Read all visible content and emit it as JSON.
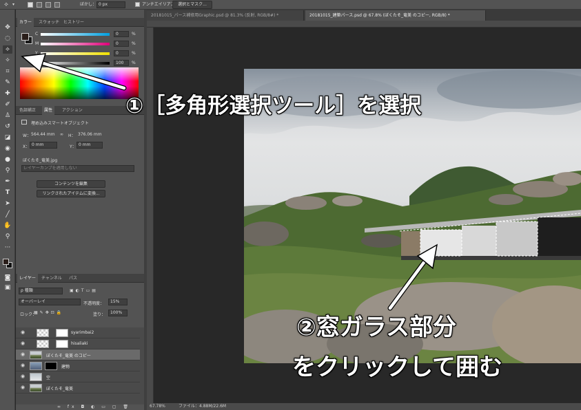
{
  "options_bar": {
    "feather_label": "ぼかし：",
    "feather_value": "0 px",
    "antialias_label": "アンチエイリアス",
    "mask_button": "選択とマスク..."
  },
  "document_tabs": [
    {
      "label": "20181015_パース補修用Graphic.psd @ 81.3% (反射, RGB/8#) *"
    },
    {
      "label": "20181015_建築パース.psd @ 67.8% (ぼくたそ_竜美 のコピー, RGB/8) *"
    }
  ],
  "color_panel": {
    "tabs": [
      "カラー",
      "スウォッチ",
      "ヒストリー"
    ],
    "channels": [
      {
        "label": "C",
        "value": "0",
        "unit": "%"
      },
      {
        "label": "M",
        "value": "0",
        "unit": "%"
      },
      {
        "label": "Y",
        "value": "0",
        "unit": "%"
      },
      {
        "label": "K",
        "value": "100",
        "unit": "%"
      }
    ]
  },
  "properties_panel": {
    "tabs": [
      "色調補正",
      "属性",
      "アクション"
    ],
    "type": "埋め込みスマートオブジェクト",
    "w_label": "W：",
    "w_value": "564.44 mm",
    "h_label": "H：",
    "h_value": "376.06 mm",
    "x_label": "X：",
    "x_value": "0 mm",
    "y_label": "Y：",
    "y_value": "0 mm",
    "file_name": "ぼくたそ_竜美.jpg",
    "comp_placeholder": "レイヤーカンプを適用しない",
    "edit_contents_button": "コンテンツを編集",
    "relink_button": "リンクされたアイテムに変換..."
  },
  "layers_panel": {
    "tabs": [
      "レイヤー",
      "チャンネル",
      "パス"
    ],
    "filter_label": "ρ 種類",
    "blend_mode": "オーバーレイ",
    "opacity_label": "不透明度：",
    "opacity_value": "15%",
    "lock_label": "ロック：",
    "fill_label": "塗り：",
    "fill_value": "100%",
    "layers": [
      {
        "name": "syarimbai2"
      },
      {
        "name": "hisaliaki"
      },
      {
        "name": "ぼくたそ_竜美 のコピー"
      },
      {
        "name": "建物"
      },
      {
        "name": "空"
      },
      {
        "name": "ぼくたそ_竜美"
      }
    ]
  },
  "status": {
    "zoom": "67.78%",
    "file_info": "ファイル：4.88M/22.6M"
  },
  "annotations": {
    "step1": "①［多角形選択ツール］を選択",
    "step2_line1": "②窓ガラス部分",
    "step2_line2": "をクリックして囲む"
  }
}
